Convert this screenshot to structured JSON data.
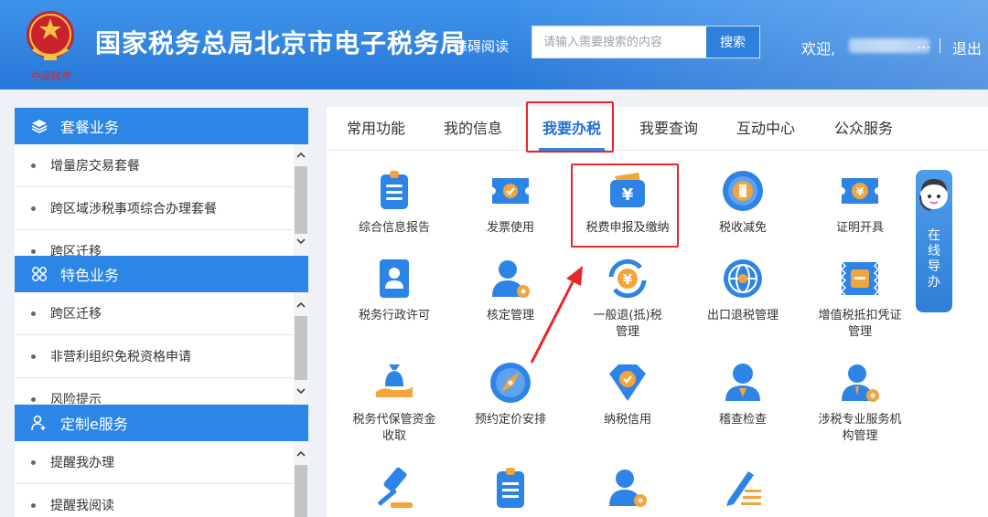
{
  "header": {
    "site_title": "国家税务总局北京市电子税务局",
    "emblem_caption": "中国税务",
    "access_label": "障碍阅读",
    "search_placeholder": "请输入需要搜索的内容",
    "search_button": "搜索",
    "welcome": "欢迎,",
    "ellipsis": "...",
    "logout": "退出"
  },
  "sidebar": [
    {
      "title": "套餐业务",
      "icon": "layers-icon",
      "items": [
        "增量房交易套餐",
        "跨区域涉税事项综合办理套餐",
        "跨区迁移"
      ]
    },
    {
      "title": "特色业务",
      "icon": "grid-icon",
      "items": [
        "跨区迁移",
        "非营利组织免税资格申请",
        "风险提示"
      ]
    },
    {
      "title": "定制e服务",
      "icon": "user-add-icon",
      "items": [
        "提醒我办理",
        "提醒我阅读"
      ]
    }
  ],
  "tabs": [
    "常用功能",
    "我的信息",
    "我要办税",
    "我要查询",
    "互动中心",
    "公众服务"
  ],
  "active_tab": "我要办税",
  "functions": [
    {
      "label": "综合信息报告",
      "icon": "report-icon"
    },
    {
      "label": "发票使用",
      "icon": "invoice-icon"
    },
    {
      "label": "税费申报及缴纳",
      "icon": "wallet-yuan-icon"
    },
    {
      "label": "税收减免",
      "icon": "tax-relief-icon"
    },
    {
      "label": "证明开具",
      "icon": "certificate-icon"
    },
    {
      "label": "税务行政许可",
      "icon": "license-icon"
    },
    {
      "label": "核定管理",
      "icon": "user-gear-icon"
    },
    {
      "label": "一般退(抵)税管理",
      "icon": "refund-icon"
    },
    {
      "label": "出口退税管理",
      "icon": "globe-icon"
    },
    {
      "label": "增值税抵扣凭证管理",
      "icon": "vat-voucher-icon"
    },
    {
      "label": "税务代保管资金收取",
      "icon": "money-bag-icon"
    },
    {
      "label": "预约定价安排",
      "icon": "compass-icon"
    },
    {
      "label": "纳税信用",
      "icon": "credit-icon"
    },
    {
      "label": "稽查检查",
      "icon": "inspector-icon"
    },
    {
      "label": "涉税专业服务机构管理",
      "icon": "agency-icon"
    },
    {
      "label": "",
      "icon": "gavel-icon"
    },
    {
      "label": "",
      "icon": "clipboard-icon"
    },
    {
      "label": "",
      "icon": "user-gear-icon"
    },
    {
      "label": "",
      "icon": "pen-list-icon"
    }
  ],
  "online_guide": "在线导办",
  "colors": {
    "header_blue": "#2b86e6",
    "highlight_red": "#e8262a",
    "active_tab": "#1f6fd6"
  }
}
